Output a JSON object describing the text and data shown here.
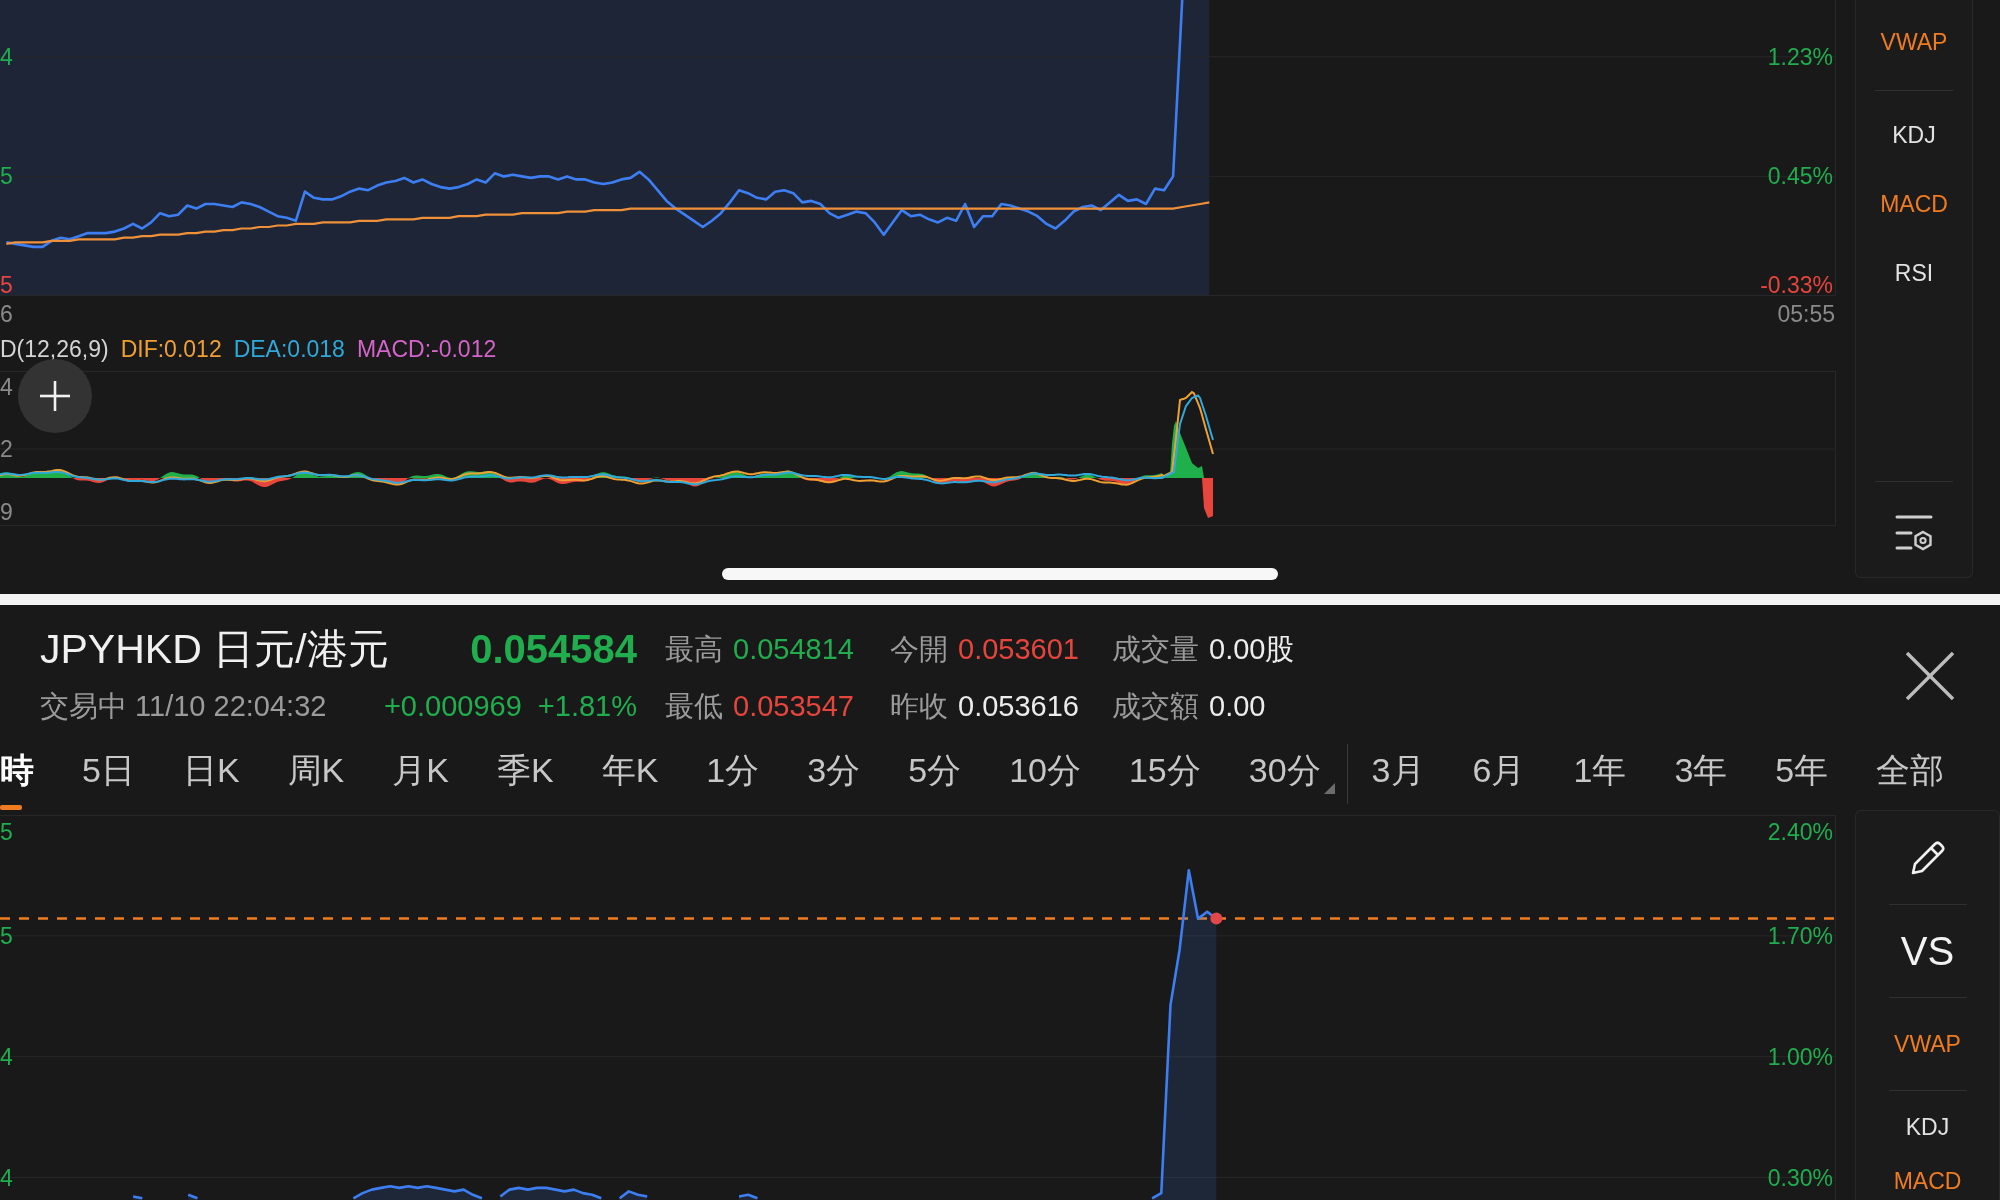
{
  "top_pane": {
    "price_chart": {
      "left_ticks": [
        "4",
        "5",
        "5"
      ],
      "chart_data": {
        "type": "line",
        "grid": true,
        "categories": [
          "6",
          null,
          null,
          null,
          null,
          null,
          null,
          null,
          null,
          null,
          null,
          null,
          null,
          null,
          null,
          null,
          null,
          null,
          null,
          null,
          null,
          null,
          null,
          null,
          null,
          null,
          null,
          null,
          null,
          null,
          null,
          null,
          null,
          null,
          null,
          null,
          null,
          null,
          null,
          null,
          null,
          null,
          null,
          null,
          null,
          null,
          null,
          null,
          null,
          null,
          null,
          null,
          null,
          null,
          null,
          null,
          null,
          null,
          null,
          null,
          null,
          null,
          null,
          null,
          null,
          null,
          null,
          null,
          null,
          null,
          null,
          null,
          null,
          null,
          null,
          null,
          null,
          null,
          null,
          null,
          null,
          null,
          null,
          null,
          null,
          null,
          null,
          null,
          null,
          null,
          null,
          null,
          null,
          null,
          null,
          null,
          null,
          null,
          null,
          null,
          null,
          null,
          null,
          null,
          null,
          null,
          null,
          null,
          null,
          null,
          null,
          null,
          null,
          null,
          null,
          null,
          null,
          null,
          null,
          null,
          null,
          null,
          null,
          null,
          null,
          null,
          null,
          null,
          null,
          null,
          null,
          null,
          null,
          null,
          null,
          null,
          null,
          null,
          null,
          null,
          null,
          null,
          null,
          null,
          null,
          null,
          null,
          null,
          null,
          null,
          null,
          null,
          null,
          null,
          null,
          null,
          null,
          null,
          null,
          null,
          null,
          null,
          null,
          null,
          null,
          null,
          null,
          null,
          null,
          null,
          null,
          null,
          null,
          null,
          null,
          null,
          null,
          null,
          null,
          null,
          null,
          null,
          null,
          null,
          null,
          null,
          null,
          null,
          null,
          null,
          null,
          null,
          null,
          null,
          null,
          null,
          null,
          null,
          null,
          "05:55"
        ],
        "ylim": [
          -0.33,
          1.6
        ],
        "yticks": [
          {
            "value": 1.23,
            "label": "1.23%"
          },
          {
            "value": 0.45,
            "label": "0.45%"
          },
          {
            "value": -0.33,
            "label": "-0.33%"
          }
        ],
        "series": [
          {
            "color": "#3d7ff2",
            "values": [
              0.02,
              0.01,
              0,
              -0.01,
              -0.01,
              0.03,
              0.05,
              0.04,
              0.06,
              0.08,
              0.08,
              0.08,
              0.09,
              0.11,
              0.14,
              0.11,
              0.15,
              0.21,
              0.19,
              0.2,
              0.26,
              0.24,
              0.27,
              0.27,
              0.26,
              0.25,
              0.28,
              0.27,
              0.25,
              0.22,
              0.19,
              0.18,
              0.16,
              0.35,
              0.31,
              0.3,
              0.3,
              0.32,
              0.35,
              0.37,
              0.36,
              0.39,
              0.41,
              0.42,
              0.44,
              0.41,
              0.43,
              0.4,
              0.38,
              0.37,
              0.38,
              0.4,
              0.43,
              0.41,
              0.47,
              0.45,
              0.46,
              0.45,
              0.44,
              0.45,
              0.45,
              0.43,
              0.45,
              0.43,
              0.43,
              0.41,
              0.4,
              0.41,
              0.43,
              0.44,
              0.48,
              0.43,
              0.36,
              0.29,
              0.24,
              0.2,
              0.16,
              0.12,
              0.16,
              0.21,
              0.28,
              0.36,
              0.34,
              0.31,
              0.3,
              0.35,
              0.36,
              0.34,
              0.28,
              0.29,
              0.27,
              0.21,
              0.18,
              0.2,
              0.22,
              0.21,
              0.15,
              0.07,
              0.15,
              0.23,
              0.19,
              0.2,
              0.17,
              0.15,
              0.18,
              0.16,
              0.27,
              0.12,
              0.19,
              0.19,
              0.27,
              0.26,
              0.24,
              0.22,
              0.19,
              0.14,
              0.11,
              0.16,
              0.22,
              0.25,
              0.26,
              0.23,
              0.28,
              0.33,
              0.29,
              0.3,
              0.27,
              0.37,
              0.36,
              0.45,
              1.6,
              null,
              null,
              null,
              null,
              null,
              null,
              null,
              null,
              null,
              null,
              null,
              null,
              null,
              null,
              null,
              null,
              null,
              null,
              null,
              null,
              null,
              null,
              null,
              null,
              null,
              null,
              null,
              null,
              null,
              null,
              null,
              null,
              null,
              null,
              null,
              null,
              null,
              null,
              null,
              null,
              null,
              null,
              null,
              null,
              null,
              null,
              null,
              null,
              null,
              null,
              null,
              null,
              null,
              null,
              null,
              null,
              null,
              null,
              null,
              null,
              null,
              null,
              null,
              null,
              null,
              null,
              null,
              null,
              null
            ]
          },
          {
            "color": "#f0913a",
            "values": [
              0.01,
              0.02,
              0.02,
              0.02,
              0.02,
              0.03,
              0.03,
              0.03,
              0.04,
              0.04,
              0.04,
              0.04,
              0.04,
              0.05,
              0.05,
              0.06,
              0.06,
              0.07,
              0.07,
              0.07,
              0.08,
              0.08,
              0.09,
              0.09,
              0.1,
              0.1,
              0.11,
              0.11,
              0.12,
              0.12,
              0.13,
              0.13,
              0.14,
              0.14,
              0.14,
              0.15,
              0.15,
              0.15,
              0.15,
              0.16,
              0.16,
              0.16,
              0.17,
              0.17,
              0.17,
              0.17,
              0.18,
              0.18,
              0.18,
              0.18,
              0.19,
              0.19,
              0.19,
              0.2,
              0.2,
              0.2,
              0.2,
              0.21,
              0.21,
              0.21,
              0.21,
              0.21,
              0.22,
              0.22,
              0.22,
              0.23,
              0.23,
              0.23,
              0.23,
              0.24,
              0.24,
              0.24,
              0.24,
              0.24,
              0.24,
              0.24,
              0.24,
              0.24,
              0.24,
              0.24,
              0.24,
              0.24,
              0.24,
              0.24,
              0.24,
              0.24,
              0.24,
              0.24,
              0.24,
              0.24,
              0.24,
              0.24,
              0.24,
              0.24,
              0.24,
              0.24,
              0.24,
              0.24,
              0.24,
              0.24,
              0.24,
              0.24,
              0.24,
              0.24,
              0.24,
              0.24,
              0.24,
              0.24,
              0.24,
              0.24,
              0.24,
              0.24,
              0.24,
              0.24,
              0.24,
              0.24,
              0.24,
              0.24,
              0.24,
              0.24,
              0.24,
              0.24,
              0.24,
              0.24,
              0.24,
              0.24,
              0.24,
              0.24,
              0.24,
              0.24,
              0.25,
              0.26,
              0.27,
              0.28,
              null,
              null,
              null,
              null,
              null,
              null,
              null,
              null,
              null,
              null,
              null,
              null,
              null,
              null,
              null,
              null,
              null,
              null,
              null,
              null,
              null,
              null,
              null,
              null,
              null,
              null,
              null,
              null,
              null,
              null,
              null,
              null,
              null,
              null,
              null,
              null,
              null,
              null,
              null,
              null,
              null,
              null,
              null,
              null,
              null,
              null,
              null,
              null,
              null,
              null,
              null,
              null,
              null,
              null,
              null,
              null,
              null,
              null,
              null,
              null,
              null,
              null,
              null,
              null,
              null,
              null
            ]
          }
        ]
      }
    },
    "macd": {
      "legend": [
        {
          "text": "D(12,26,9)",
          "color": "#d4d4d4"
        },
        {
          "text": "DIF:0.012",
          "color": "#f0a033"
        },
        {
          "text": "DEA:0.018",
          "color": "#2fa8dc"
        },
        {
          "text": "MACD:-0.012",
          "color": "#d464cb"
        }
      ],
      "left_ticks": [
        "4",
        "2",
        "9"
      ]
    },
    "indicator_panel": {
      "groups": [
        [
          {
            "label": "VWAP",
            "selected": true
          }
        ],
        [
          {
            "label": "KDJ",
            "selected": false
          },
          {
            "label": "MACD",
            "selected": true
          },
          {
            "label": "RSI",
            "selected": false
          }
        ]
      ]
    }
  },
  "bottom_pane": {
    "quote": {
      "symbol": "JPYHKD 日元/港元",
      "price": "0.054584",
      "rising": true,
      "status": "交易中 11/10 22:04:32",
      "change": "+0.000969",
      "change_percent": "+1.81%",
      "stats": [
        {
          "label": "最高",
          "value": "0.054814",
          "color": "#20ad4e"
        },
        {
          "label": "今開",
          "value": "0.053601",
          "color": "#e6453d"
        },
        {
          "label": "成交量",
          "value": "0.00股",
          "color": "#ececec"
        },
        {
          "label": "最低",
          "value": "0.053547",
          "color": "#e6453d"
        },
        {
          "label": "昨收",
          "value": "0.053616",
          "color": "#ececec"
        },
        {
          "label": "成交額",
          "value": "0.00",
          "color": "#ececec"
        }
      ]
    },
    "intervals": [
      [
        {
          "label": "時",
          "selected": true,
          "menu": false
        },
        {
          "label": "5日",
          "selected": false,
          "menu": false
        },
        {
          "label": "日K",
          "selected": false,
          "menu": false
        },
        {
          "label": "周K",
          "selected": false,
          "menu": false
        },
        {
          "label": "月K",
          "selected": false,
          "menu": false
        },
        {
          "label": "季K",
          "selected": false,
          "menu": false
        },
        {
          "label": "年K",
          "selected": false,
          "menu": false
        },
        {
          "label": "1分",
          "selected": false,
          "menu": false
        },
        {
          "label": "3分",
          "selected": false,
          "menu": false
        },
        {
          "label": "5分",
          "selected": false,
          "menu": false
        },
        {
          "label": "10分",
          "selected": false,
          "menu": false
        },
        {
          "label": "15分",
          "selected": false,
          "menu": false
        },
        {
          "label": "30分",
          "selected": false,
          "menu": true
        }
      ],
      [
        {
          "label": "3月",
          "selected": false,
          "menu": false
        },
        {
          "label": "6月",
          "selected": false,
          "menu": false
        },
        {
          "label": "1年",
          "selected": false,
          "menu": false
        },
        {
          "label": "3年",
          "selected": false,
          "menu": false
        },
        {
          "label": "5年",
          "selected": false,
          "menu": false
        },
        {
          "label": "全部",
          "selected": false,
          "menu": false
        }
      ]
    ],
    "price_chart": {
      "left_ticks": [
        "5",
        "5",
        "4",
        "4"
      ],
      "chart_data": {
        "type": "area",
        "grid": true,
        "categories": [
          null,
          null,
          null,
          null,
          null,
          null,
          null,
          null,
          null,
          null,
          null,
          null,
          null,
          null,
          null,
          null,
          null,
          null,
          null,
          null,
          null,
          null,
          null,
          null,
          null,
          null,
          null,
          null,
          null,
          null,
          null,
          null,
          null,
          null,
          null,
          null,
          null,
          null,
          null,
          null,
          null,
          null,
          null,
          null,
          null,
          null,
          null,
          null,
          null,
          null,
          null,
          null,
          null,
          null,
          null,
          null,
          null,
          null,
          null,
          null,
          null,
          null,
          null,
          null,
          null,
          null,
          null,
          null,
          null,
          null,
          null,
          null,
          null,
          null,
          null,
          null,
          null,
          null,
          null,
          null,
          null,
          null,
          null,
          null,
          null,
          null,
          null,
          null,
          null,
          null,
          null,
          null,
          null,
          null,
          null,
          null,
          null,
          null,
          null,
          null,
          null,
          null,
          null,
          null,
          null,
          null,
          null,
          null,
          null,
          null,
          null,
          null,
          null,
          null,
          null,
          null,
          null,
          null,
          null,
          null,
          null,
          null,
          null,
          null,
          null,
          null,
          null,
          null,
          null,
          null,
          null,
          null,
          null,
          null,
          null,
          null,
          null,
          null,
          null,
          null,
          null,
          null,
          null,
          null,
          null,
          null,
          null,
          null,
          null,
          null,
          null,
          null,
          null,
          null,
          null,
          null,
          null,
          null,
          null,
          null,
          null,
          null,
          null,
          null,
          null,
          null,
          null,
          null,
          null,
          null,
          null,
          null,
          null,
          null,
          null,
          null,
          null,
          null,
          null,
          null,
          null,
          null,
          null,
          null,
          null,
          null,
          null,
          null,
          null,
          null,
          null,
          null,
          null,
          null,
          null,
          null,
          null,
          null,
          null,
          null
        ],
        "ylim": [
          0.17,
          2.4
        ],
        "yticks": [
          {
            "value": 2.4,
            "label": "2.40%"
          },
          {
            "value": 1.7,
            "label": "1.70%"
          },
          {
            "value": 1.0,
            "label": "1.00%"
          },
          {
            "value": 0.3,
            "label": "0.30%"
          }
        ],
        "ref_lines": [
          {
            "axis": "y",
            "value": 1.8
          }
        ],
        "series": [
          {
            "color": "#3d7ff2",
            "values": [
              null,
              null,
              null,
              null,
              null,
              null,
              null,
              null,
              null,
              null,
              null,
              null,
              null,
              null,
              0.19,
              0.18,
              null,
              null,
              null,
              null,
              0.2,
              0.18,
              null,
              null,
              null,
              null,
              null,
              null,
              null,
              null,
              null,
              null,
              null,
              null,
              null,
              null,
              null,
              null,
              0.18,
              0.21,
              0.23,
              0.24,
              0.25,
              0.24,
              0.25,
              0.24,
              0.25,
              0.24,
              0.23,
              0.22,
              0.23,
              0.2,
              0.18,
              null,
              0.19,
              0.23,
              0.24,
              0.23,
              0.24,
              0.24,
              0.23,
              0.22,
              0.23,
              0.21,
              0.2,
              0.18,
              null,
              0.18,
              0.22,
              0.2,
              0.19,
              null,
              null,
              null,
              null,
              null,
              null,
              null,
              null,
              null,
              0.19,
              0.2,
              0.18,
              null,
              null,
              null,
              null,
              null,
              null,
              null,
              null,
              null,
              null,
              null,
              null,
              null,
              null,
              null,
              null,
              null,
              null,
              null,
              null,
              null,
              null,
              null,
              null,
              null,
              null,
              null,
              null,
              null,
              null,
              null,
              null,
              null,
              null,
              null,
              null,
              null,
              null,
              null,
              null,
              null,
              null,
              0.18,
              0.21,
              1.3,
              1.62,
              2.08,
              1.8,
              1.84,
              1.8,
              null,
              null,
              null,
              null,
              null,
              null,
              null,
              null,
              null,
              null,
              null,
              null,
              null,
              null,
              null,
              null,
              null,
              null,
              null,
              null,
              null,
              null,
              null,
              null,
              null,
              null,
              null,
              null,
              null,
              null,
              null,
              null,
              null,
              null,
              null,
              null,
              null,
              null,
              null,
              null,
              null,
              null,
              null,
              null,
              null,
              null,
              null,
              null,
              null,
              null,
              null,
              null,
              null,
              null,
              null,
              null,
              null,
              null,
              null,
              null,
              null,
              null,
              null,
              null,
              null,
              null,
              null
            ]
          }
        ]
      }
    },
    "tool_panel": {
      "compare_label": "VS",
      "groups": [
        [
          {
            "label": "VWAP",
            "selected": true
          }
        ],
        [
          {
            "label": "KDJ",
            "selected": false
          },
          {
            "label": "MACD",
            "selected": true
          }
        ]
      ]
    }
  }
}
